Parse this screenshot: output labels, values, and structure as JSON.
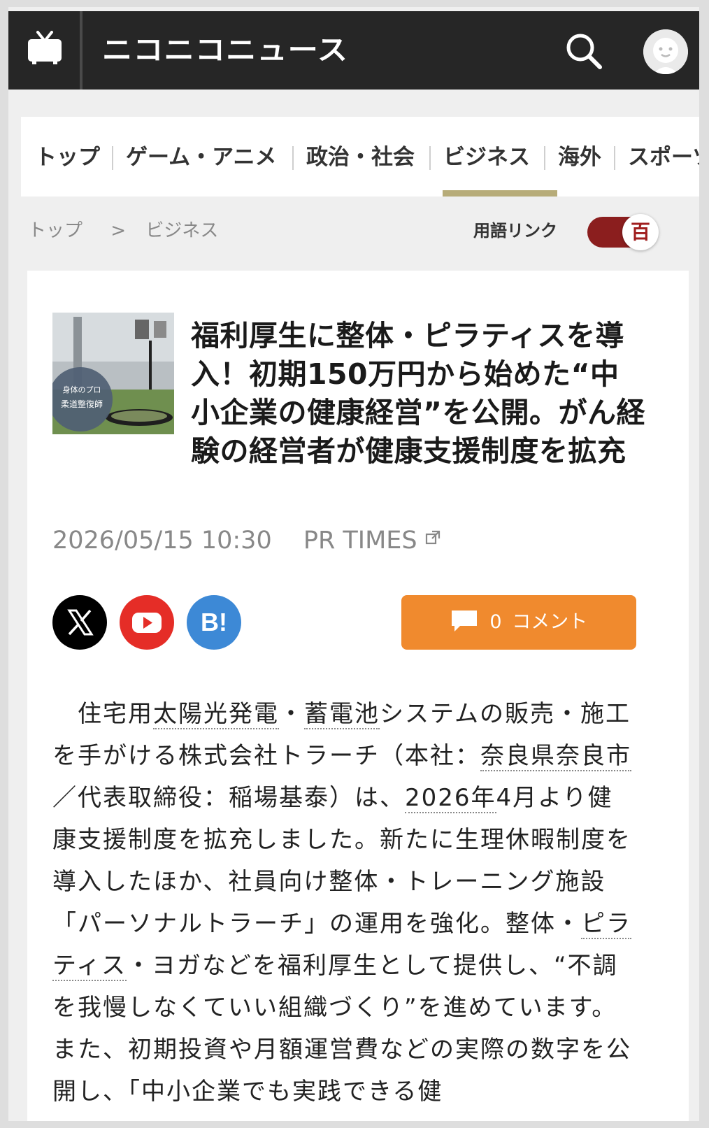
{
  "header": {
    "logo": "ニコニコニュース",
    "icons": [
      "tv-icon",
      "search-icon",
      "user-avatar-icon"
    ]
  },
  "nav": {
    "items": [
      "トップ",
      "ゲーム・アニメ",
      "政治・社会",
      "ビジネス",
      "海外",
      "スポーツ"
    ],
    "active": "ビジネス",
    "active_color": "#b7ac79"
  },
  "breadcrumb": {
    "items": [
      "トップ",
      ">",
      "ビジネス"
    ]
  },
  "term_link": {
    "label": "用語リンク",
    "toggle_glyph": "百",
    "toggle_color": "#8b1e1e"
  },
  "article": {
    "thumbnail_text_line1": "身体のプロ",
    "thumbnail_text_line2": "柔道整復師",
    "title": "福利厚生に整体・ピラティスを導入！初期150万円から始めた“中小企業の健康経営”を公開。がん経験の経営者が健康支援制度を拡充",
    "date": "2026/05/15 10:30",
    "source": "PR TIMES",
    "share": [
      "x-icon",
      "youtube-icon",
      "hatena-bookmark-icon"
    ],
    "hatena_label": "B!",
    "comment_count": "0",
    "comment_label": "コメント",
    "comment_color": "#f08a2e",
    "body": {
      "p1": "住宅用",
      "link1": "太陽光発電",
      "p2": "・",
      "link2": "蓄電池",
      "p3": "システムの販売・施工を手がける株式会社トラーチ（本社：",
      "link3": "奈良県奈良市",
      "p4": "／代表取締役：稲場基泰）は、",
      "link4": "2026年",
      "p5": "4月より健康支援制度を拡充しました。新たに生理休暇制度を導入したほか、社員向け整体・トレーニング施設「パーソナルトラーチ」の運用を強化。整体・",
      "link5": "ピラティス",
      "p6": "・ヨガなどを福利厚生として提供し、“不調を我慢しなくていい組織づくり”を進めています。また、初期投資や月額運営費などの実際の数字を公開し、「中小企業でも実践できる健"
    }
  }
}
